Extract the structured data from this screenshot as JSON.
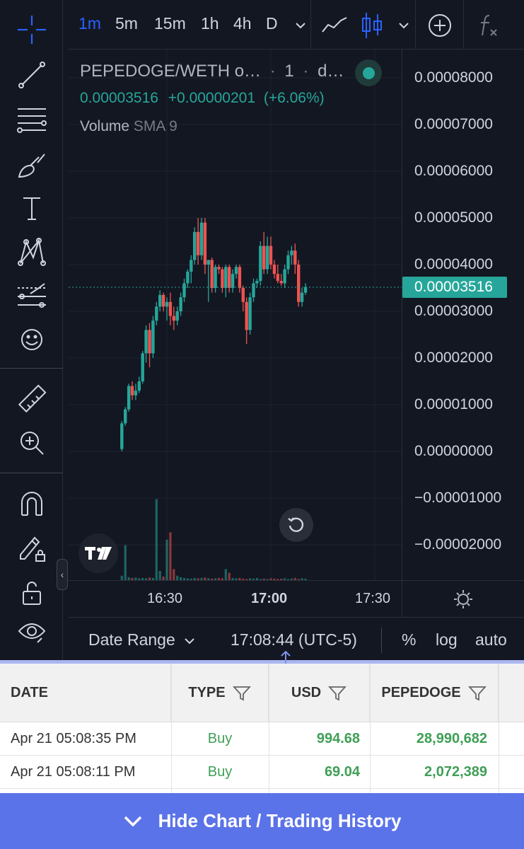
{
  "top_toolbar": {
    "intervals": [
      {
        "label": "1m",
        "active": true
      },
      {
        "label": "5m",
        "active": false
      },
      {
        "label": "15m",
        "active": false
      },
      {
        "label": "1h",
        "active": false
      },
      {
        "label": "4h",
        "active": false
      },
      {
        "label": "D",
        "active": false
      }
    ],
    "icons": [
      "chevron-down-icon",
      "line-chart-icon",
      "candles-icon",
      "chevron-down-icon",
      "add-circle-icon",
      "indicators-fx-icon"
    ]
  },
  "left_toolbar": {
    "tools": [
      "crosshair-icon",
      "trend-line-icon",
      "fib-lines-icon",
      "brush-icon",
      "text-icon",
      "pattern-icon",
      "prediction-icon",
      "emoji-icon",
      "ruler-icon",
      "zoom-in-icon",
      "magnet-icon",
      "lock-drawing-icon",
      "unlock-icon",
      "eye-icon"
    ]
  },
  "legend": {
    "symbol": "PEPEDOGE/WETH o…",
    "interval": "1",
    "exchange": "d…",
    "price": "0.00003516",
    "change": "+0.00000201",
    "change_pct": "(+6.06%)",
    "volume_label": "Volume",
    "volume_sma": "SMA 9"
  },
  "colors": {
    "up": "#26a69a",
    "down": "#ef5350",
    "background": "#131722",
    "accent": "#2962ff",
    "table_green": "#3f9f56",
    "footer": "#5b73e8"
  },
  "price_axis": {
    "labels": [
      "0.00008000",
      "0.00007000",
      "0.00006000",
      "0.00005000",
      "0.00004000",
      "0.00003000",
      "0.00002000",
      "0.00001000",
      "0.00000000",
      "−0.00001000",
      "−0.00002000"
    ],
    "current_price": "0.00003516"
  },
  "time_axis": {
    "labels": [
      {
        "text": "16:30",
        "bold": false
      },
      {
        "text": "17:00",
        "bold": true
      },
      {
        "text": "17:30",
        "bold": false
      }
    ]
  },
  "bottom_bar": {
    "date_range": "Date Range",
    "clock": "17:08:44 (UTC-5)",
    "percent": "%",
    "log": "log",
    "auto": "auto"
  },
  "table": {
    "headers": [
      "DATE",
      "TYPE",
      "USD",
      "PEPEDOGE"
    ],
    "rows": [
      {
        "date": "Apr 21 05:08:35 PM",
        "type": "Buy",
        "usd": "994.68",
        "amount": "28,990,682"
      },
      {
        "date": "Apr 21 05:08:11 PM",
        "type": "Buy",
        "usd": "69.04",
        "amount": "2,072,389"
      }
    ]
  },
  "footer": {
    "label": "Hide Chart / Trading History"
  },
  "chart_data": {
    "type": "candlestick",
    "ylim": [
      -2e-05,
      8e-05
    ],
    "x_ticks": [
      "16:30",
      "17:00",
      "17:30"
    ],
    "tick_minutes": [
      30,
      60,
      90
    ],
    "candles": [
      {
        "t": 17,
        "o": 5e-07,
        "h": 6.5e-06,
        "l": 0.0,
        "c": 6e-06
      },
      {
        "t": 18,
        "o": 6e-06,
        "h": 9.5e-06,
        "l": 5.5e-06,
        "c": 9e-06
      },
      {
        "t": 19,
        "o": 9e-06,
        "h": 1.45e-05,
        "l": 8.5e-06,
        "c": 1.4e-05
      },
      {
        "t": 20,
        "o": 1.4e-05,
        "h": 1.5e-05,
        "l": 1.1e-05,
        "c": 1.2e-05
      },
      {
        "t": 21,
        "o": 1.2e-05,
        "h": 1.45e-05,
        "l": 1.1e-05,
        "c": 1.3e-05
      },
      {
        "t": 22,
        "o": 1.3e-05,
        "h": 1.6e-05,
        "l": 1.25e-05,
        "c": 1.5e-05
      },
      {
        "t": 23,
        "o": 1.5e-05,
        "h": 2.15e-05,
        "l": 1.45e-05,
        "c": 2.1e-05
      },
      {
        "t": 24,
        "o": 2.1e-05,
        "h": 2.7e-05,
        "l": 1.9e-05,
        "c": 2.6e-05
      },
      {
        "t": 25,
        "o": 2.6e-05,
        "h": 2.75e-05,
        "l": 1.8e-05,
        "c": 2.1e-05
      },
      {
        "t": 26,
        "o": 2.1e-05,
        "h": 2.9e-05,
        "l": 2e-05,
        "c": 2.8e-05
      },
      {
        "t": 27,
        "o": 2.8e-05,
        "h": 3.2e-05,
        "l": 2.7e-05,
        "c": 3.1e-05
      },
      {
        "t": 28,
        "o": 3.1e-05,
        "h": 3.45e-05,
        "l": 3e-05,
        "c": 3.35e-05
      },
      {
        "t": 29,
        "o": 3.35e-05,
        "h": 3.4e-05,
        "l": 3e-05,
        "c": 3.1e-05
      },
      {
        "t": 30,
        "o": 3.1e-05,
        "h": 3.3e-05,
        "l": 2.8e-05,
        "c": 3.2e-05
      },
      {
        "t": 31,
        "o": 3.2e-05,
        "h": 3.4e-05,
        "l": 2.7e-05,
        "c": 2.9e-05
      },
      {
        "t": 32,
        "o": 2.9e-05,
        "h": 3.1e-05,
        "l": 2.6e-05,
        "c": 2.8e-05
      },
      {
        "t": 33,
        "o": 2.8e-05,
        "h": 3.1e-05,
        "l": 2.7e-05,
        "c": 3e-05
      },
      {
        "t": 34,
        "o": 3e-05,
        "h": 3.4e-05,
        "l": 2.9e-05,
        "c": 3.3e-05
      },
      {
        "t": 35,
        "o": 3.3e-05,
        "h": 3.7e-05,
        "l": 3.2e-05,
        "c": 3.6e-05
      },
      {
        "t": 36,
        "o": 3.6e-05,
        "h": 3.9e-05,
        "l": 3.5e-05,
        "c": 3.85e-05
      },
      {
        "t": 37,
        "o": 3.85e-05,
        "h": 4.2e-05,
        "l": 3.6e-05,
        "c": 4.1e-05
      },
      {
        "t": 38,
        "o": 4.1e-05,
        "h": 4.8e-05,
        "l": 4e-05,
        "c": 4.7e-05
      },
      {
        "t": 39,
        "o": 4.7e-05,
        "h": 5e-05,
        "l": 4e-05,
        "c": 4.2e-05
      },
      {
        "t": 40,
        "o": 4.2e-05,
        "h": 5e-05,
        "l": 4.1e-05,
        "c": 4.9e-05
      },
      {
        "t": 41,
        "o": 4.9e-05,
        "h": 5e-05,
        "l": 3.8e-05,
        "c": 4e-05
      },
      {
        "t": 42,
        "o": 4e-05,
        "h": 4.1e-05,
        "l": 3.2e-05,
        "c": 4.1e-05
      },
      {
        "t": 43,
        "o": 4.1e-05,
        "h": 4.15e-05,
        "l": 3.4e-05,
        "c": 3.5e-05
      },
      {
        "t": 44,
        "o": 3.5e-05,
        "h": 4e-05,
        "l": 3.4e-05,
        "c": 3.95e-05
      },
      {
        "t": 45,
        "o": 3.95e-05,
        "h": 4e-05,
        "l": 3.8e-05,
        "c": 3.9e-05
      },
      {
        "t": 46,
        "o": 3.9e-05,
        "h": 3.95e-05,
        "l": 3.4e-05,
        "c": 3.5e-05
      },
      {
        "t": 47,
        "o": 3.5e-05,
        "h": 4e-05,
        "l": 3.3e-05,
        "c": 3.95e-05
      },
      {
        "t": 48,
        "o": 3.95e-05,
        "h": 4e-05,
        "l": 3.4e-05,
        "c": 3.5e-05
      },
      {
        "t": 49,
        "o": 3.5e-05,
        "h": 3.9e-05,
        "l": 3.4e-05,
        "c": 3.8e-05
      },
      {
        "t": 50,
        "o": 3.8e-05,
        "h": 4e-05,
        "l": 3.7e-05,
        "c": 3.95e-05
      },
      {
        "t": 51,
        "o": 3.95e-05,
        "h": 4e-05,
        "l": 3.4e-05,
        "c": 3.5e-05
      },
      {
        "t": 52,
        "o": 3.5e-05,
        "h": 3.55e-05,
        "l": 3e-05,
        "c": 3.2e-05
      },
      {
        "t": 53,
        "o": 3.2e-05,
        "h": 3.3e-05,
        "l": 2.3e-05,
        "c": 2.6e-05
      },
      {
        "t": 54,
        "o": 2.6e-05,
        "h": 3.4e-05,
        "l": 2.5e-05,
        "c": 3.3e-05
      },
      {
        "t": 55,
        "o": 3.3e-05,
        "h": 3.7e-05,
        "l": 3.2e-05,
        "c": 3.6e-05
      },
      {
        "t": 56,
        "o": 3.6e-05,
        "h": 3.7e-05,
        "l": 3.5e-05,
        "c": 3.65e-05
      },
      {
        "t": 57,
        "o": 3.65e-05,
        "h": 4.5e-05,
        "l": 3.55e-05,
        "c": 4.4e-05
      },
      {
        "t": 58,
        "o": 4.4e-05,
        "h": 4.7e-05,
        "l": 3.8e-05,
        "c": 3.9e-05
      },
      {
        "t": 59,
        "o": 3.9e-05,
        "h": 4.6e-05,
        "l": 3.8e-05,
        "c": 4.4e-05
      },
      {
        "t": 60,
        "o": 4.4e-05,
        "h": 4.6e-05,
        "l": 3.9e-05,
        "c": 4e-05
      },
      {
        "t": 61,
        "o": 4e-05,
        "h": 4.1e-05,
        "l": 3.7e-05,
        "c": 3.8e-05
      },
      {
        "t": 62,
        "o": 3.8e-05,
        "h": 4e-05,
        "l": 3.6e-05,
        "c": 3.65e-05
      },
      {
        "t": 63,
        "o": 3.65e-05,
        "h": 3.8e-05,
        "l": 3.55e-05,
        "c": 3.6e-05
      },
      {
        "t": 64,
        "o": 3.6e-05,
        "h": 4e-05,
        "l": 3.5e-05,
        "c": 3.9e-05
      },
      {
        "t": 65,
        "o": 3.9e-05,
        "h": 4.3e-05,
        "l": 3.8e-05,
        "c": 4.2e-05
      },
      {
        "t": 66,
        "o": 4.2e-05,
        "h": 4.4e-05,
        "l": 4e-05,
        "c": 4.3e-05
      },
      {
        "t": 67,
        "o": 4.3e-05,
        "h": 4.45e-05,
        "l": 3.8e-05,
        "c": 4e-05
      },
      {
        "t": 68,
        "o": 4e-05,
        "h": 4.1e-05,
        "l": 3.1e-05,
        "c": 3.2e-05
      },
      {
        "t": 69,
        "o": 3.2e-05,
        "h": 3.5e-05,
        "l": 3.1e-05,
        "c": 3.4e-05
      },
      {
        "t": 70,
        "o": 3.4e-05,
        "h": 3.6e-05,
        "l": 3.35e-05,
        "c": 3.52e-05
      }
    ],
    "volume_max": 1.0,
    "volumes": [
      0.12,
      0.95,
      0.08,
      0.06,
      0.07,
      0.05,
      0.06,
      0.05,
      0.07,
      0.06,
      2.2,
      0.25,
      0.1,
      1.1,
      1.3,
      0.3,
      0.12,
      0.08,
      0.06,
      0.05,
      0.04,
      0.06,
      0.05,
      0.06,
      0.07,
      0.05,
      0.04,
      0.05,
      0.06,
      0.05,
      0.3,
      0.2,
      0.06,
      0.05,
      0.06,
      0.04,
      0.03,
      0.05,
      0.04,
      0.06,
      0.03,
      0.04,
      0.03,
      0.05,
      0.04,
      0.03,
      0.04,
      0.05,
      0.03,
      0.04,
      0.06,
      0.03,
      0.05,
      0.04
    ],
    "current_price": 3.516e-05
  }
}
